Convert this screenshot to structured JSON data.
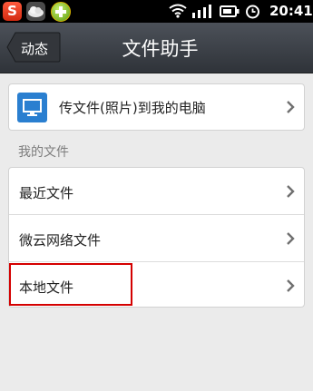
{
  "status_bar": {
    "time": "20:41",
    "icons": [
      "weibo-icon",
      "cloud-icon",
      "plus-icon",
      "wifi-icon",
      "signal-icon",
      "battery-icon",
      "alarm-icon"
    ]
  },
  "header": {
    "back_label": "动态",
    "title": "文件助手"
  },
  "transfer": {
    "label": "传文件(照片)到我的电脑",
    "icon": "monitor-icon"
  },
  "my_files": {
    "section_title": "我的文件",
    "items": [
      {
        "label": "最近文件"
      },
      {
        "label": "微云网络文件"
      },
      {
        "label": "本地文件",
        "highlighted": true
      }
    ]
  },
  "colors": {
    "title_bar": "#3d4148",
    "highlight": "#d40000",
    "icon_blue": "#2a7fd0",
    "background": "#ebebeb"
  }
}
